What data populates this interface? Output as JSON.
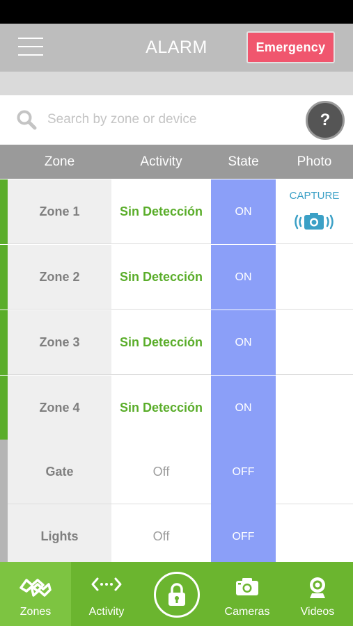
{
  "header": {
    "title": "ALARM",
    "emergency_label": "Emergency"
  },
  "search": {
    "placeholder": "Search by zone or device",
    "help_label": "?"
  },
  "table": {
    "columns": [
      "Zone",
      "Activity",
      "State",
      "Photo"
    ],
    "rows": [
      {
        "zone": "Zone 1",
        "activity": "Sin Detección",
        "state": "ON",
        "accent": "#5aad2a"
      },
      {
        "zone": "Zone 2",
        "activity": "Sin Detección",
        "state": "ON",
        "accent": "#5aad2a"
      },
      {
        "zone": "Zone 3",
        "activity": "Sin Detección",
        "state": "ON",
        "accent": "#5aad2a"
      },
      {
        "zone": "Zone 4",
        "activity": "Sin Detección",
        "state": "ON",
        "accent": "#5aad2a"
      },
      {
        "zone": "Gate",
        "activity": "Off",
        "state": "OFF",
        "accent": "#b5b5b5"
      },
      {
        "zone": "Lights",
        "activity": "Off",
        "state": "OFF",
        "accent": "#b5b5b5"
      }
    ],
    "capture_label": "CAPTURE"
  },
  "tabbar": {
    "zones": "Zones",
    "activity": "Activity",
    "cameras": "Cameras",
    "videos": "Videos"
  },
  "colors": {
    "brand_green": "#6bb52f",
    "active_green": "#5aad2a",
    "state_blue": "#8b9ff8",
    "emergency_red": "#f0566e",
    "capture_blue": "#3ba0c6"
  }
}
